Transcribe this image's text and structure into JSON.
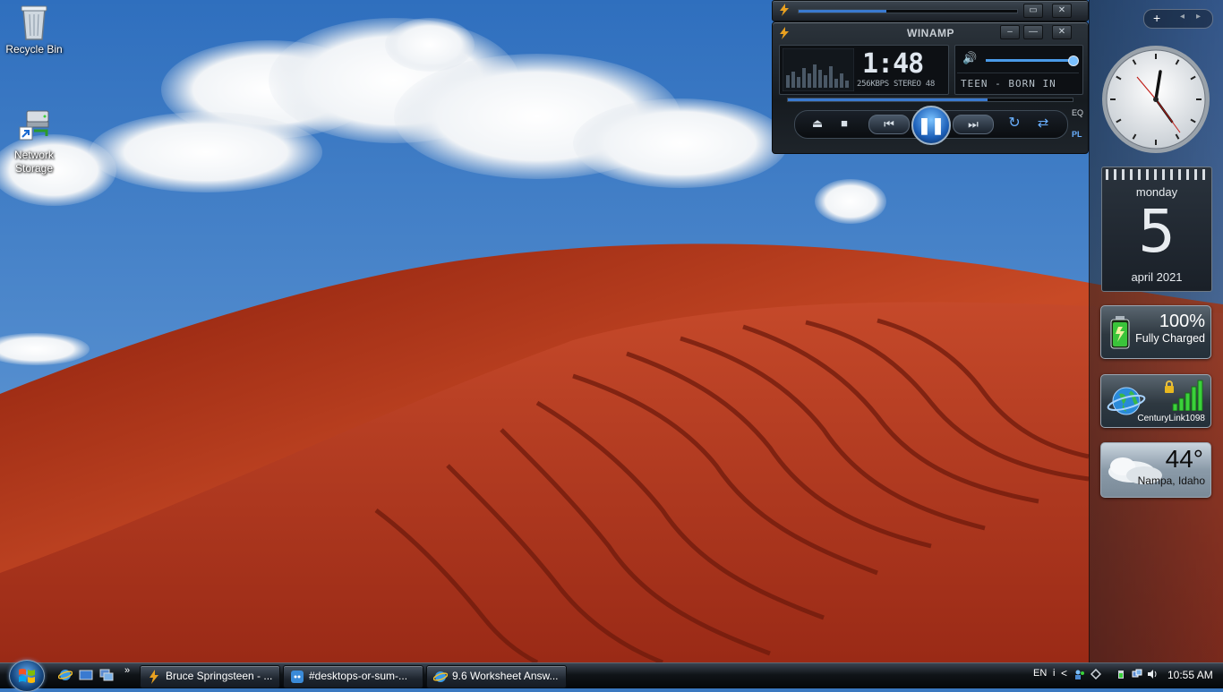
{
  "desktop": {
    "icons": [
      {
        "label": "Recycle Bin",
        "icon": "recycle-bin-icon"
      },
      {
        "label": "Network\nStorage",
        "icon": "network-storage-icon"
      }
    ]
  },
  "winamp": {
    "title": "WINAMP",
    "time": "1:48",
    "info": "256KBPS STEREO 48",
    "ticker": "TEEN - BORN IN",
    "eq_label": "EQ",
    "pl_label": "PL",
    "volume_fraction": 0.97,
    "seek_fraction": 0.7,
    "state": "playing"
  },
  "sidebar": {
    "calendar": {
      "day": "monday",
      "date": "5",
      "month_year": "april 2021"
    },
    "battery": {
      "percent": "100%",
      "status": "Fully Charged"
    },
    "wifi": {
      "network": "CenturyLink1098"
    },
    "weather": {
      "temp": "44°",
      "location": "Nampa, Idaho"
    }
  },
  "taskbar": {
    "quicklaunch_more": "»",
    "tasks": [
      {
        "label": "Bruce Springsteen - ...",
        "icon": "winamp-icon"
      },
      {
        "label": "#desktops-or-sum-...",
        "icon": "discord-icon"
      },
      {
        "label": "9.6 Worksheet Answ...",
        "icon": "ie-icon"
      }
    ],
    "tray": {
      "lang": "EN",
      "time": "10:55 AM"
    }
  },
  "colors": {
    "accent": "#1c5fb8",
    "dune": "#b23a1c",
    "sky": "#3a78c0"
  }
}
